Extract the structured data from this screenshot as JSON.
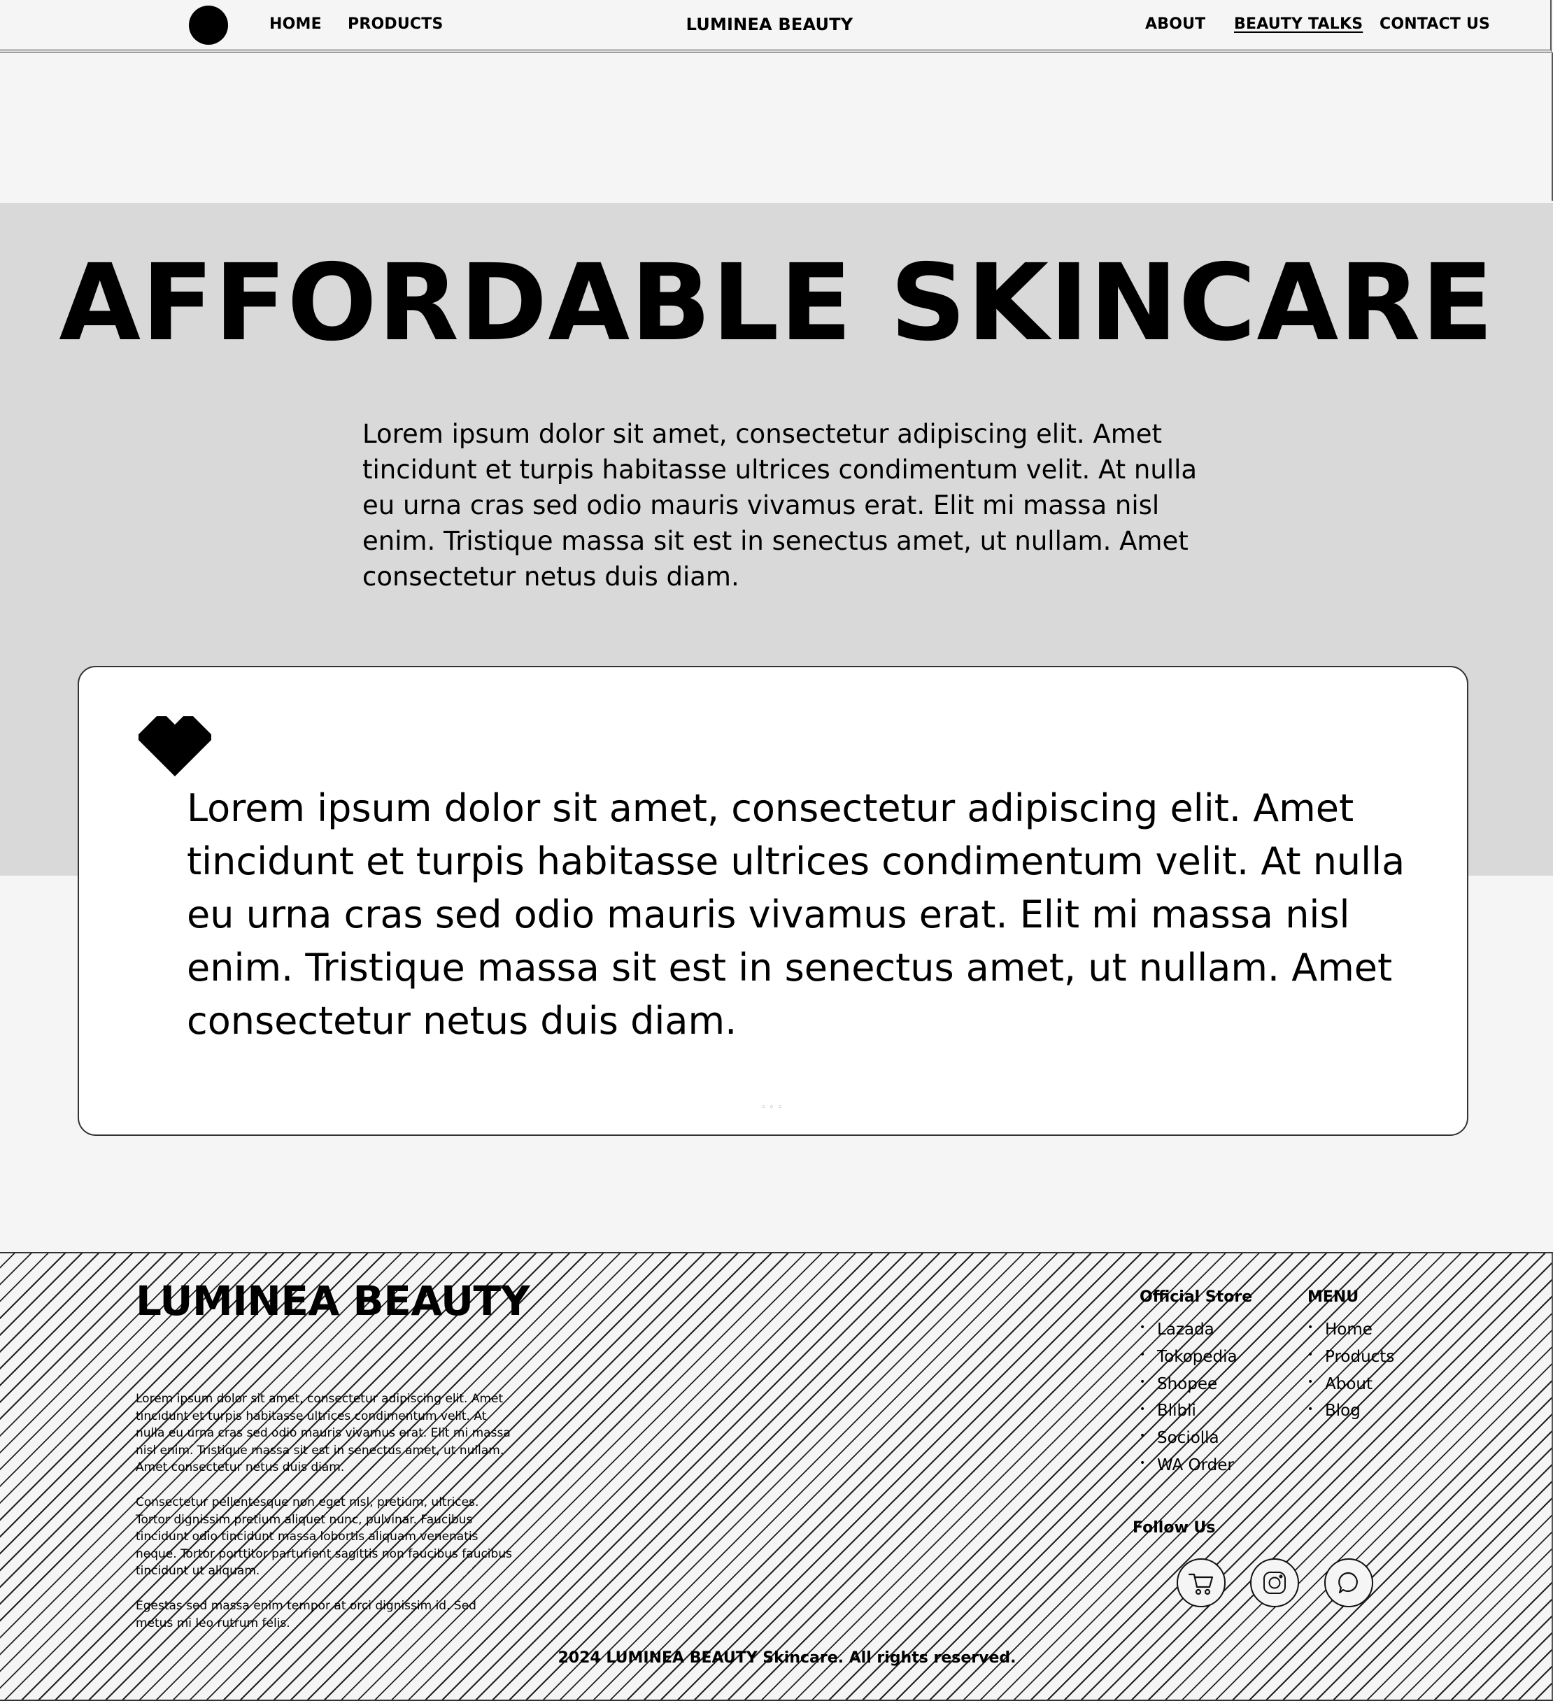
{
  "nav": {
    "home": "HOME",
    "products": "PRODUCTS",
    "brand": "LUMINEA BEAUTY",
    "about": "ABOUT",
    "beauty_talks": "BEAUTY TALKS",
    "contact": "CONTACT US"
  },
  "hero": {
    "title": "AFFORDABLE SKINCARE",
    "text": "Lorem ipsum dolor sit amet, consectetur adipiscing elit. Amet tincidunt et turpis habitasse ultrices condimentum velit. At nulla eu urna cras sed odio mauris vivamus erat. Elit mi massa nisl enim. Tristique massa sit est in senectus amet, ut nullam. Amet consectetur netus duis diam."
  },
  "card": {
    "icon": "heart-icon",
    "text": "Lorem ipsum dolor sit amet, consectetur adipiscing elit. Amet tincidunt et turpis habitasse ultrices condimentum velit. At nulla eu urna cras sed odio mauris vivamus erat. Elit mi massa nisl enim. Tristique massa sit est in senectus amet, ut nullam. Amet consectetur netus duis diam.",
    "dots": "◦◦◦"
  },
  "footer": {
    "brand": "LUMINEA BEAUTY",
    "paragraphs": [
      "Lorem ipsum dolor sit amet, consectetur adipiscing elit. Amet tincidunt et turpis habitasse ultrices condimentum velit. At nulla eu urna cras sed odio mauris vivamus erat. Elit mi massa nisl enim. Tristique massa sit est in senectus amet, ut nullam. Amet consectetur netus duis diam.",
      "Consectetur pellentesque non eget nisl, pretium, ultrices. Tortor dignissim pretium aliquet nunc, pulvinar. Faucibus tincidunt odio tincidunt massa lobortis aliquam venenatis neque. Tortor porttitor parturient sagittis non faucibus faucibus tincidunt ut aliquam.",
      "Egestas sed massa enim tempor at orci dignissim id. Sed metus mi leo rutrum felis."
    ],
    "store_title": "Official Store",
    "store_items": [
      "Lazada",
      "Tokopedia",
      "Shopee",
      "Blibli",
      "Sociolla",
      "WA Order"
    ],
    "menu_title": "MENU",
    "menu_items": [
      "Home",
      "Products",
      "About",
      "Blog"
    ],
    "follow_title": "Follow Us",
    "social_icons": [
      "cart-icon",
      "instagram-icon",
      "chat-icon"
    ],
    "copyright": "2024 LUMINEA BEAUTY Skincare. All rights reserved."
  }
}
